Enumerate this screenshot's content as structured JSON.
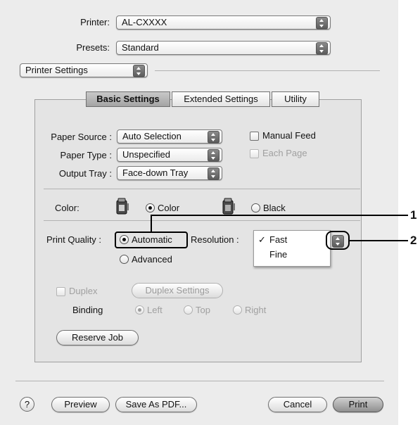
{
  "header": {
    "printer_label": "Printer:",
    "printer_value": "AL-CXXXX",
    "presets_label": "Presets:",
    "presets_value": "Standard",
    "panel_value": "Printer Settings"
  },
  "tabs": [
    {
      "label": "Basic Settings",
      "active": true
    },
    {
      "label": "Extended Settings",
      "active": false
    },
    {
      "label": "Utility",
      "active": false
    }
  ],
  "paper": {
    "source_label": "Paper Source :",
    "source_value": "Auto Selection",
    "type_label": "Paper Type :",
    "type_value": "Unspecified",
    "tray_label": "Output Tray :",
    "tray_value": "Face-down Tray",
    "manual_feed_label": "Manual Feed",
    "each_page_label": "Each Page"
  },
  "color": {
    "label": "Color:",
    "option_color": "Color",
    "option_black": "Black",
    "selected": "Color"
  },
  "quality": {
    "label": "Print Quality :",
    "option_automatic": "Automatic",
    "option_advanced": "Advanced",
    "selected": "Automatic",
    "resolution_label": "Resolution :",
    "resolution_options": [
      "Fast",
      "Fine"
    ],
    "resolution_selected": "Fast",
    "checkmark": "✓"
  },
  "duplex": {
    "checkbox_label": "Duplex",
    "settings_button": "Duplex Settings",
    "binding_label": "Binding",
    "option_left": "Left",
    "option_top": "Top",
    "option_right": "Right",
    "selected": "Left"
  },
  "reserve_job_button": "Reserve Job",
  "footer": {
    "help_label": "?",
    "preview_button": "Preview",
    "save_pdf_button": "Save As PDF...",
    "cancel_button": "Cancel",
    "print_button": "Print"
  },
  "callouts": [
    "1",
    "2"
  ]
}
